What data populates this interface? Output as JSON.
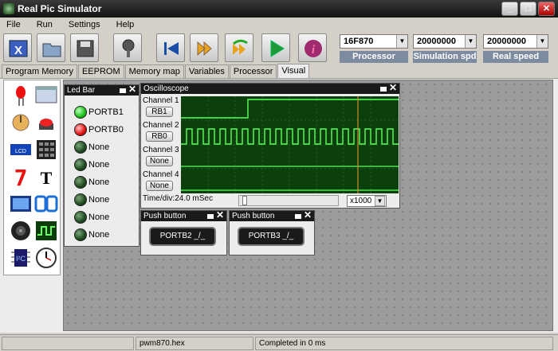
{
  "window": {
    "title": "Real Pic Simulator"
  },
  "menu": [
    "File",
    "Run",
    "Settings",
    "Help"
  ],
  "toolbar": {
    "buttons": [
      "close-project",
      "open",
      "save",
      "probe",
      "reset",
      "step",
      "step-over",
      "run",
      "info"
    ],
    "processor": {
      "value": "16F870",
      "label": "Processor"
    },
    "sim_speed": {
      "value": "20000000",
      "label": "Simulation spd"
    },
    "real_speed": {
      "value": "20000000",
      "label": "Real speed"
    }
  },
  "tabs": [
    "Program Memory",
    "EEPROM",
    "Memory map",
    "Variables",
    "Processor",
    "Visual"
  ],
  "palette": [
    "led",
    "lcd-screen",
    "potentiometer",
    "push-button",
    "lcd-text",
    "keypad",
    "seven-segment",
    "text",
    "graphic-lcd",
    "indicator",
    "buzzer",
    "oscilloscope",
    "ic",
    "clock"
  ],
  "led_bar": {
    "title": "Led Bar",
    "leds": [
      {
        "label": "PORTB1",
        "state": "green"
      },
      {
        "label": "PORTB0",
        "state": "red"
      },
      {
        "label": "None",
        "state": "off"
      },
      {
        "label": "None",
        "state": "off"
      },
      {
        "label": "None",
        "state": "off"
      },
      {
        "label": "None",
        "state": "off"
      },
      {
        "label": "None",
        "state": "off"
      },
      {
        "label": "None",
        "state": "off"
      }
    ]
  },
  "oscilloscope": {
    "title": "Oscilloscope",
    "channels": [
      {
        "label": "Channel 1",
        "pin": "RB1"
      },
      {
        "label": "Channel 2",
        "pin": "RB0"
      },
      {
        "label": "Channel 3",
        "pin": "None"
      },
      {
        "label": "Channel 4",
        "pin": "None"
      }
    ],
    "timediv": "Time/div:24.0 mSec",
    "multiplier": "x1000"
  },
  "push_buttons": [
    {
      "title": "Push button",
      "label": "PORTB2 _/_"
    },
    {
      "title": "Push button",
      "label": "PORTB3 _/_"
    }
  ],
  "status": {
    "file": "pwm870.hex",
    "message": "Completed in 0 ms"
  }
}
